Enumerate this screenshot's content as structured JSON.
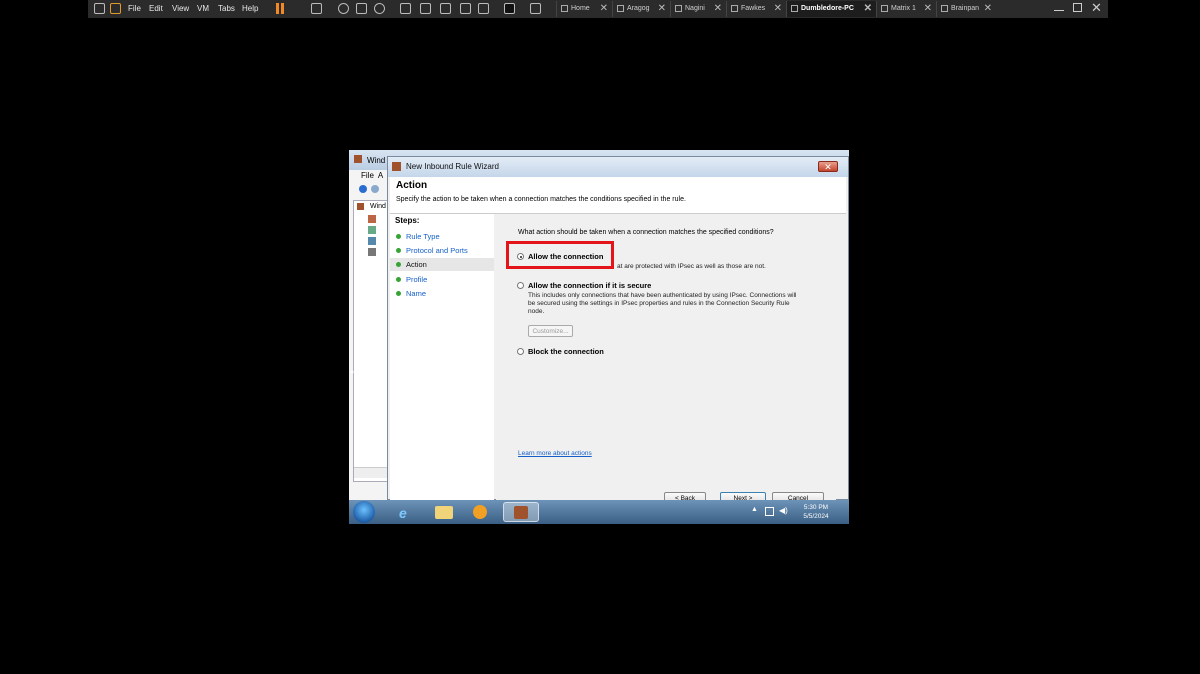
{
  "vmware": {
    "menus": [
      "File",
      "Edit",
      "View",
      "VM",
      "Tabs",
      "Help"
    ],
    "tabs": [
      {
        "label": "Home",
        "active": false
      },
      {
        "label": "Aragog",
        "active": false
      },
      {
        "label": "Nagini",
        "active": false
      },
      {
        "label": "Fawkes",
        "active": false
      },
      {
        "label": "Dumbledore-PC",
        "active": true
      },
      {
        "label": "Matrix 1",
        "active": false
      },
      {
        "label": "Brainpan",
        "active": false
      }
    ]
  },
  "mmc": {
    "title_partial": "Wind",
    "menu_partial": "File  A",
    "tree_partial": "Wind"
  },
  "wizard": {
    "title": "New Inbound Rule Wizard",
    "close_glyph": "✕",
    "header": "Action",
    "subheader": "Specify the action to be taken when a connection matches the conditions specified in the rule.",
    "steps_heading": "Steps:",
    "steps": [
      "Rule Type",
      "Protocol and Ports",
      "Action",
      "Profile",
      "Name"
    ],
    "current_step": "Action",
    "question": "What action should be taken when a connection matches the specified conditions?",
    "options": {
      "allow": {
        "label": "Allow the connection",
        "desc_visible": "at are protected with IPsec as well as those are not.",
        "selected": true
      },
      "secure": {
        "label": "Allow the connection if it is secure",
        "desc": "This includes only connections that have been authenticated by using IPsec.  Connections will be secured using the settings in IPsec properties and rules in the Connection Security Rule node.",
        "selected": false
      },
      "block": {
        "label": "Block the connection",
        "selected": false
      }
    },
    "customize_label": "Customize...",
    "learn_link": "Learn more about actions",
    "buttons": {
      "back": "< Back",
      "next": "Next >",
      "cancel": "Cancel"
    }
  },
  "taskbar": {
    "time": "5:30 PM",
    "date": "5/5/2024"
  },
  "colors": {
    "highlight": "#e3151a",
    "link": "#1560c8"
  }
}
